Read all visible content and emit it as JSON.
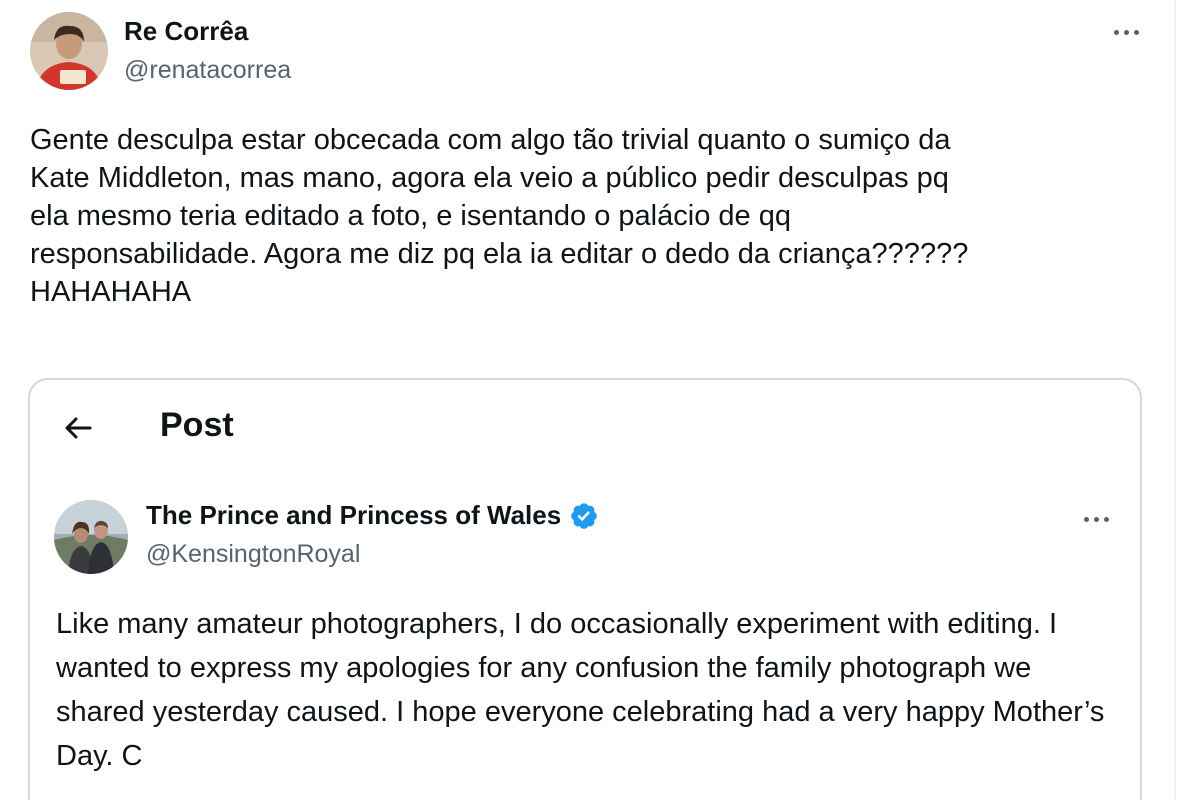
{
  "post": {
    "author": {
      "display_name": "Re Corrêa",
      "handle": "@renatacorrea"
    },
    "more_icon": "more-horizontal-icon",
    "text": "Gente desculpa estar obcecada com algo tão trivial quanto o sumiço da\nKate Middleton, mas mano, agora ela veio a público pedir desculpas pq\nela mesmo teria editado a foto, e isentando o palácio de qq\nresponsabilidade. Agora me diz pq ela ia editar o dedo da criança??????\nHAHAHAHA"
  },
  "quoted": {
    "header": {
      "back_icon": "arrow-left-icon",
      "title": "Post"
    },
    "author": {
      "display_name": "The Prince and Princess of Wales",
      "handle": "@KensingtonRoyal",
      "verified_icon": "verified-badge-icon"
    },
    "more_icon": "more-horizontal-icon",
    "text": "Like many amateur photographers, I do occasionally experiment with editing. I wanted to express my apologies for any confusion the family photograph we shared yesterday caused. I hope everyone celebrating had a very happy Mother’s Day. C"
  },
  "colors": {
    "text_primary": "#0f1419",
    "text_secondary": "#536471",
    "border": "#cfd9de",
    "verified_blue": "#1d9bf0"
  }
}
